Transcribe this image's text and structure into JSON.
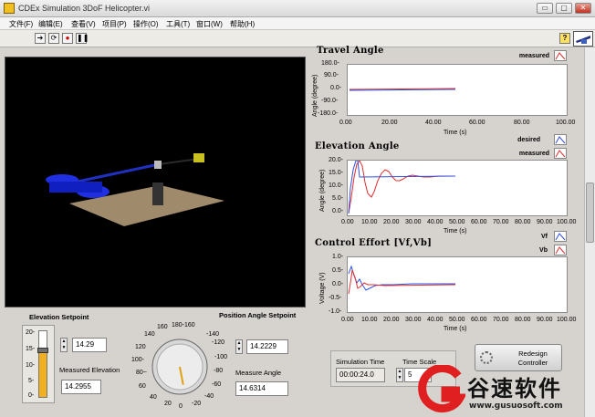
{
  "window": {
    "title": "CDEx Simulation 3DoF Helicopter.vi",
    "buttons": [
      "▭",
      "▢",
      "✕"
    ]
  },
  "menu": [
    "文件(F)",
    "编辑(E)",
    "查看(V)",
    "项目(P)",
    "操作(O)",
    "工具(T)",
    "窗口(W)",
    "帮助(H)"
  ],
  "toolbar": {
    "buttons": [
      "run-arrow-icon",
      "run-continuous-icon",
      "abort-icon",
      "pause-icon"
    ],
    "help_icon": "?"
  },
  "graphs": {
    "travel": {
      "title": "Travel Angle",
      "ylabel": "Angle (degree)",
      "xlabel": "Time (s)",
      "yticks": [
        "180.0-",
        "90.0-",
        "0.0-",
        "-90.0-",
        "-180.0-"
      ],
      "xticks": [
        "0.00",
        "20.00",
        "40.00",
        "60.00",
        "80.00",
        "100.00"
      ],
      "legend": [
        "measured"
      ]
    },
    "elevation": {
      "title": "Elevation Angle",
      "ylabel": "Angle (degree)",
      "xlabel": "Time (s)",
      "yticks": [
        "20.0-",
        "15.0-",
        "10.0-",
        "5.0-",
        "0.0-"
      ],
      "xticks": [
        "0.00",
        "10.00",
        "20.00",
        "30.00",
        "40.00",
        "50.00",
        "60.00",
        "70.00",
        "80.00",
        "90.00",
        "100.00"
      ],
      "legend": [
        "desired",
        "measured"
      ]
    },
    "control": {
      "title": "Control Effort [Vf,Vb]",
      "ylabel": "Voltage (V)",
      "xlabel": "Time (s)",
      "yticks": [
        "1.0-",
        "0.5-",
        "0.0-",
        "-0.5-",
        "-1.0-"
      ],
      "xticks": [
        "0.00",
        "10.00",
        "20.00",
        "30.00",
        "40.00",
        "50.00",
        "60.00",
        "70.00",
        "80.00",
        "90.00",
        "100.00"
      ],
      "legend": [
        "Vf",
        "Vb"
      ]
    }
  },
  "controls": {
    "elevation_setpoint_label": "Elevation Setpoint",
    "elevation_setpoint_value": "14.29",
    "slider_ticks": [
      "20-",
      "15-",
      "10-",
      "5-",
      "0-"
    ],
    "slider_level_fraction": 0.7145,
    "measured_elevation_label": "Measured Elevation",
    "measured_elevation_value": "14.2955",
    "position_angle_label": "Position Angle Setpoint",
    "position_angle_value": "14.2229",
    "measured_angle_label": "Measure Angle",
    "measured_angle_value": "14.6314",
    "knob_labels": [
      "160",
      "180-160",
      "140",
      "-140",
      "120",
      "-120",
      "100-",
      "-100",
      "80~",
      "-80",
      "60",
      "-60",
      "40",
      "-40",
      "20",
      "0",
      "-20"
    ],
    "knob_angle_deg": 14.29,
    "simulation_time_label": "Simulation Time",
    "simulation_time_value": "00:00:24.0",
    "time_scale_label": "Time Scale",
    "time_scale_value": "5",
    "redesign_button": "Redesign Controller"
  },
  "colors": {
    "desired": "#3050e0",
    "measured": "#e03030",
    "slider_fill": "#f0b020",
    "panel": "#d6d3ce"
  },
  "watermark": {
    "cn": "谷速软件",
    "url": "www.gusuosoft.com"
  }
}
